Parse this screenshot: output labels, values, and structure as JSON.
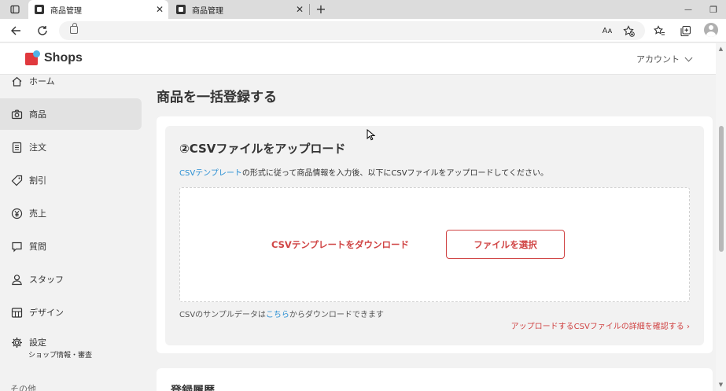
{
  "browser": {
    "tabs": [
      {
        "title": "商品管理",
        "active": true
      },
      {
        "title": "商品管理",
        "active": false
      }
    ],
    "new_tab": "+",
    "window_controls": {
      "minimize": "—",
      "restore": "❐",
      "close": "✕"
    },
    "read_aloud": "Aᴀ"
  },
  "header": {
    "logo_text": "Shops",
    "account_label": "アカウント"
  },
  "sidebar": {
    "items": [
      {
        "label": "ホーム",
        "icon": "home-icon"
      },
      {
        "label": "商品",
        "icon": "camera-icon",
        "active": true
      },
      {
        "label": "注文",
        "icon": "list-icon"
      },
      {
        "label": "割引",
        "icon": "tag-icon"
      },
      {
        "label": "売上",
        "icon": "yen-icon"
      },
      {
        "label": "質問",
        "icon": "chat-icon"
      },
      {
        "label": "スタッフ",
        "icon": "person-icon"
      },
      {
        "label": "デザイン",
        "icon": "design-icon"
      },
      {
        "label": "設定",
        "sub": "ショップ情報・審査",
        "icon": "gear-icon"
      }
    ],
    "section_other": "その他"
  },
  "main": {
    "page_title": "商品を一括登録する",
    "upload": {
      "title": "②CSVファイルをアップロード",
      "desc_link": "CSVテンプレート",
      "desc_rest": "の形式に従って商品情報を入力後、以下にCSVファイルをアップロードしてください。",
      "download_label": "CSVテンプレートをダウンロード",
      "file_button": "ファイルを選択",
      "sample_pre": "CSVのサンプルデータは",
      "sample_link": "こちら",
      "sample_post": "からダウンロードできます",
      "detail_link": "アップロードするCSVファイルの詳細を確認する ›"
    },
    "history_title": "登録履歴"
  },
  "colors": {
    "accent": "#d04444",
    "link": "#2a8fd3",
    "logo_red": "#e0393e",
    "logo_blue": "#4fb3e8"
  }
}
